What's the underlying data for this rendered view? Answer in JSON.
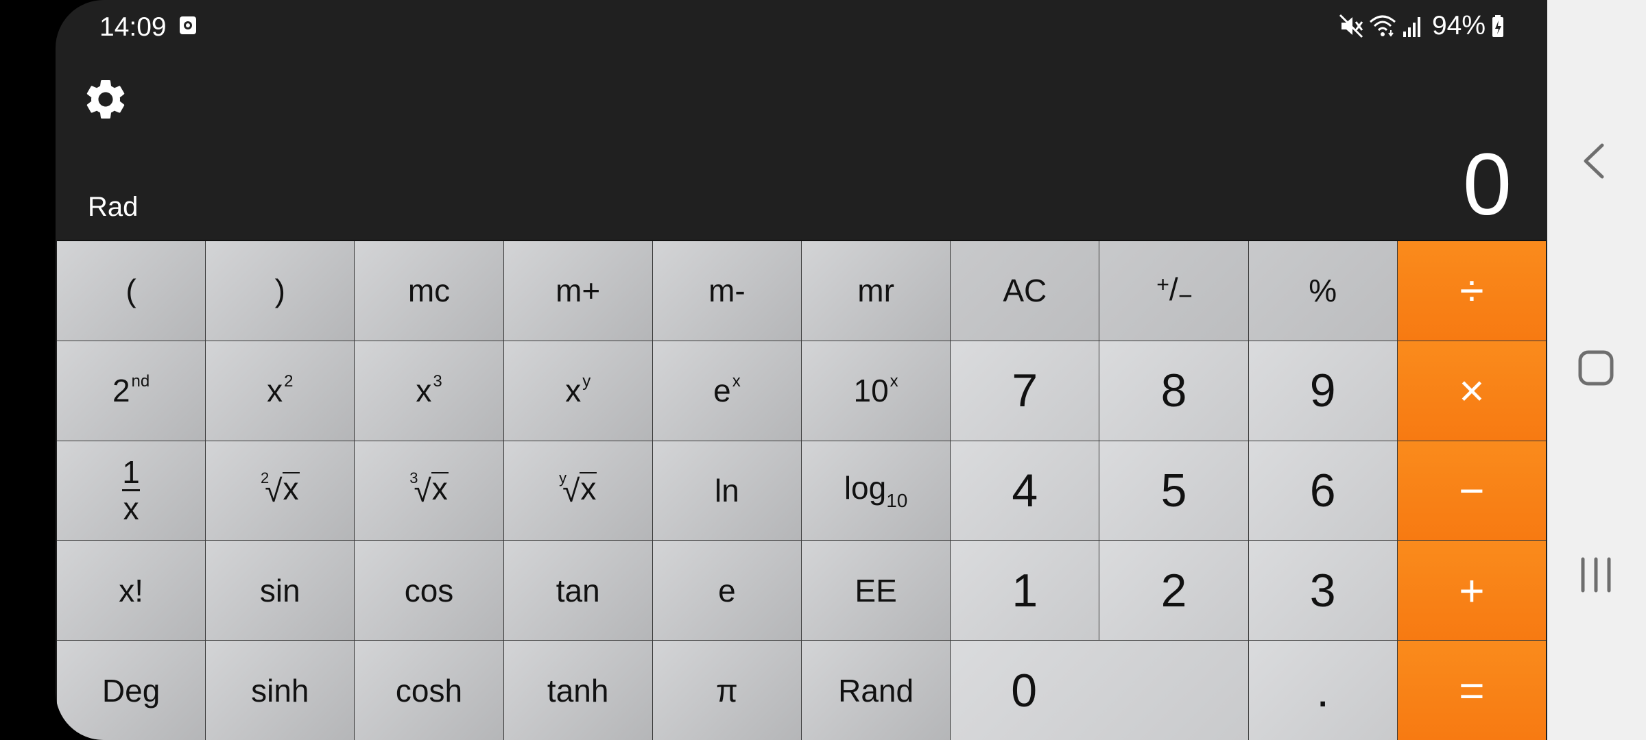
{
  "status_bar": {
    "time": "14:09",
    "battery_text": "94%",
    "icons": [
      "screenshot-icon",
      "mute-icon",
      "wifi-icon",
      "signal-icon",
      "battery-charging-icon"
    ]
  },
  "display": {
    "settings_icon": "gear-icon",
    "mode": "Rad",
    "value": "0"
  },
  "keys": {
    "open_paren": "(",
    "close_paren": ")",
    "mc": "mc",
    "m_plus": "m+",
    "m_minus": "m-",
    "mr": "mr",
    "ac": "AC",
    "plus_minus_a": "+",
    "plus_minus_b": "/",
    "plus_minus_c": "−",
    "percent": "%",
    "divide": "÷",
    "second_base": "2",
    "second_sup": "nd",
    "x_base": "x",
    "x2_sup": "2",
    "x3_sup": "3",
    "xy_sup": "y",
    "e_base": "e",
    "ex_sup": "x",
    "ten_base": "10",
    "ten_sup": "x",
    "seven": "7",
    "eight": "8",
    "nine": "9",
    "multiply": "×",
    "recip_num": "1",
    "recip_den": "x",
    "root2_idx": "2",
    "root3_idx": "3",
    "rooty_idx": "y",
    "root_sym": "√",
    "root_rad": "x",
    "ln": "ln",
    "log_base": "log",
    "log_sub": "10",
    "four": "4",
    "five": "5",
    "six": "6",
    "minus": "−",
    "factorial": "x!",
    "sin": "sin",
    "cos": "cos",
    "tan": "tan",
    "e": "e",
    "ee": "EE",
    "one": "1",
    "two": "2",
    "three": "3",
    "plus": "+",
    "deg": "Deg",
    "sinh": "sinh",
    "cosh": "cosh",
    "tanh": "tanh",
    "pi": "π",
    "rand": "Rand",
    "zero": "0",
    "dot": ".",
    "equals": "="
  },
  "nav_bar": {
    "icons": [
      "back-icon",
      "home-icon",
      "recents-icon"
    ]
  },
  "colors": {
    "operator": "#f7801a",
    "display_bg": "#202020",
    "nav_bg": "#f0f0f0"
  }
}
